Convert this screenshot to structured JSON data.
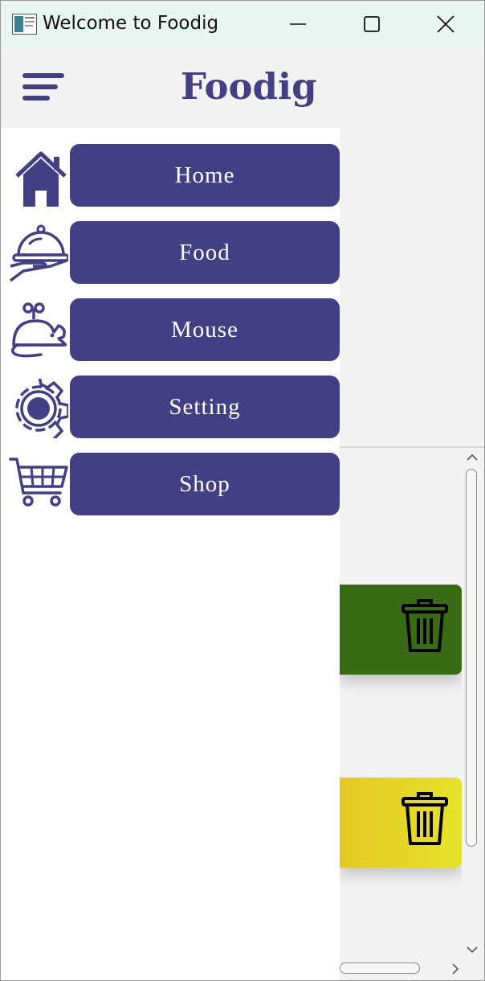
{
  "window": {
    "title": "Welcome to Foodig",
    "controls": [
      "minimize",
      "maximize",
      "close"
    ]
  },
  "header": {
    "brand": "Foodig",
    "menu_icon": "hamburger-menu-icon"
  },
  "nav": {
    "items": [
      {
        "label": "Home",
        "icon": "home-icon"
      },
      {
        "label": "Food",
        "icon": "food-cloche-icon"
      },
      {
        "label": "Mouse",
        "icon": "mouse-toy-icon"
      },
      {
        "label": "Setting",
        "icon": "gear-icon"
      },
      {
        "label": "Shop",
        "icon": "shopping-cart-icon"
      }
    ]
  },
  "cards": [
    {
      "color": "#386b14",
      "icon": "trash-icon"
    },
    {
      "color": "#e6e22a",
      "icon": "trash-icon"
    }
  ],
  "colors": {
    "accent": "#433f85",
    "titlebar": "#e8f5f1",
    "background": "#f3f3f3"
  }
}
